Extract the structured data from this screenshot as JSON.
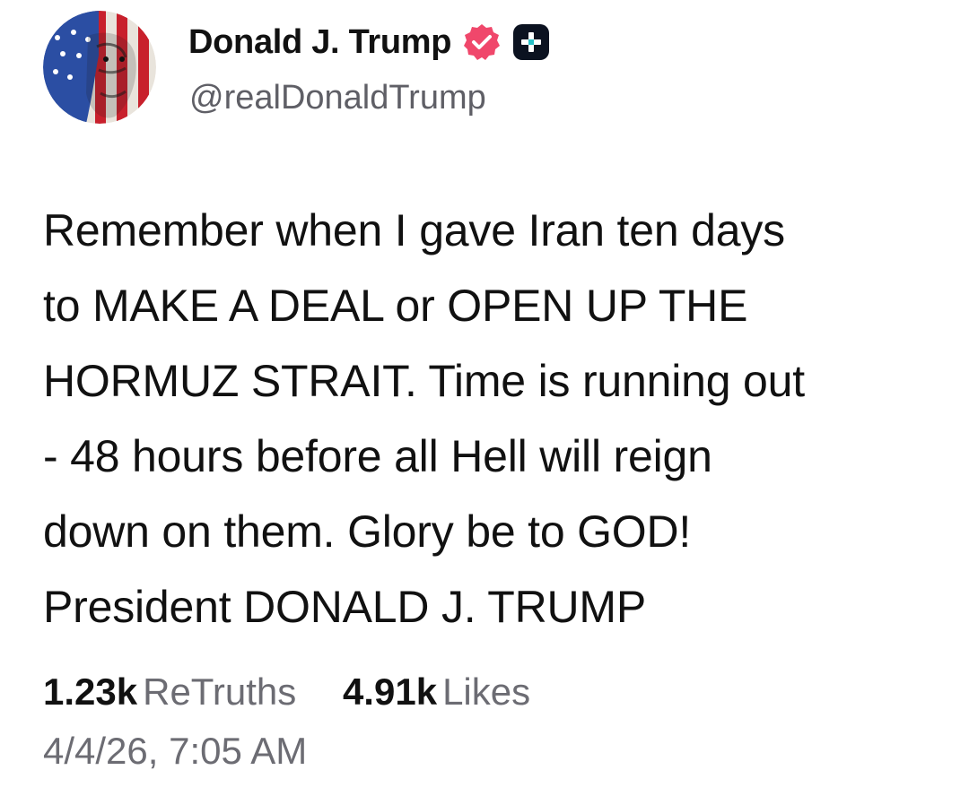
{
  "author": {
    "display_name": "Donald J. Trump",
    "handle": "@realDonaldTrump",
    "avatar_icon": "avatar-flag-portrait",
    "verified_icon": "verified-badge-icon",
    "plus_icon": "plus-badge-icon",
    "verified_color": "#f0476b"
  },
  "post": {
    "lines": [
      "Remember when I gave Iran ten days",
      "to MAKE A DEAL or OPEN UP THE",
      "HORMUZ STRAIT. Time is running out",
      "- 48 hours before all Hell will reign",
      "down on them. Glory be to GOD!",
      "President DONALD J. TRUMP"
    ]
  },
  "stats": {
    "retruths_count": "1.23k",
    "retruths_label": "ReTruths",
    "likes_count": "4.91k",
    "likes_label": "Likes"
  },
  "timestamp": "4/4/26, 7:05 AM"
}
